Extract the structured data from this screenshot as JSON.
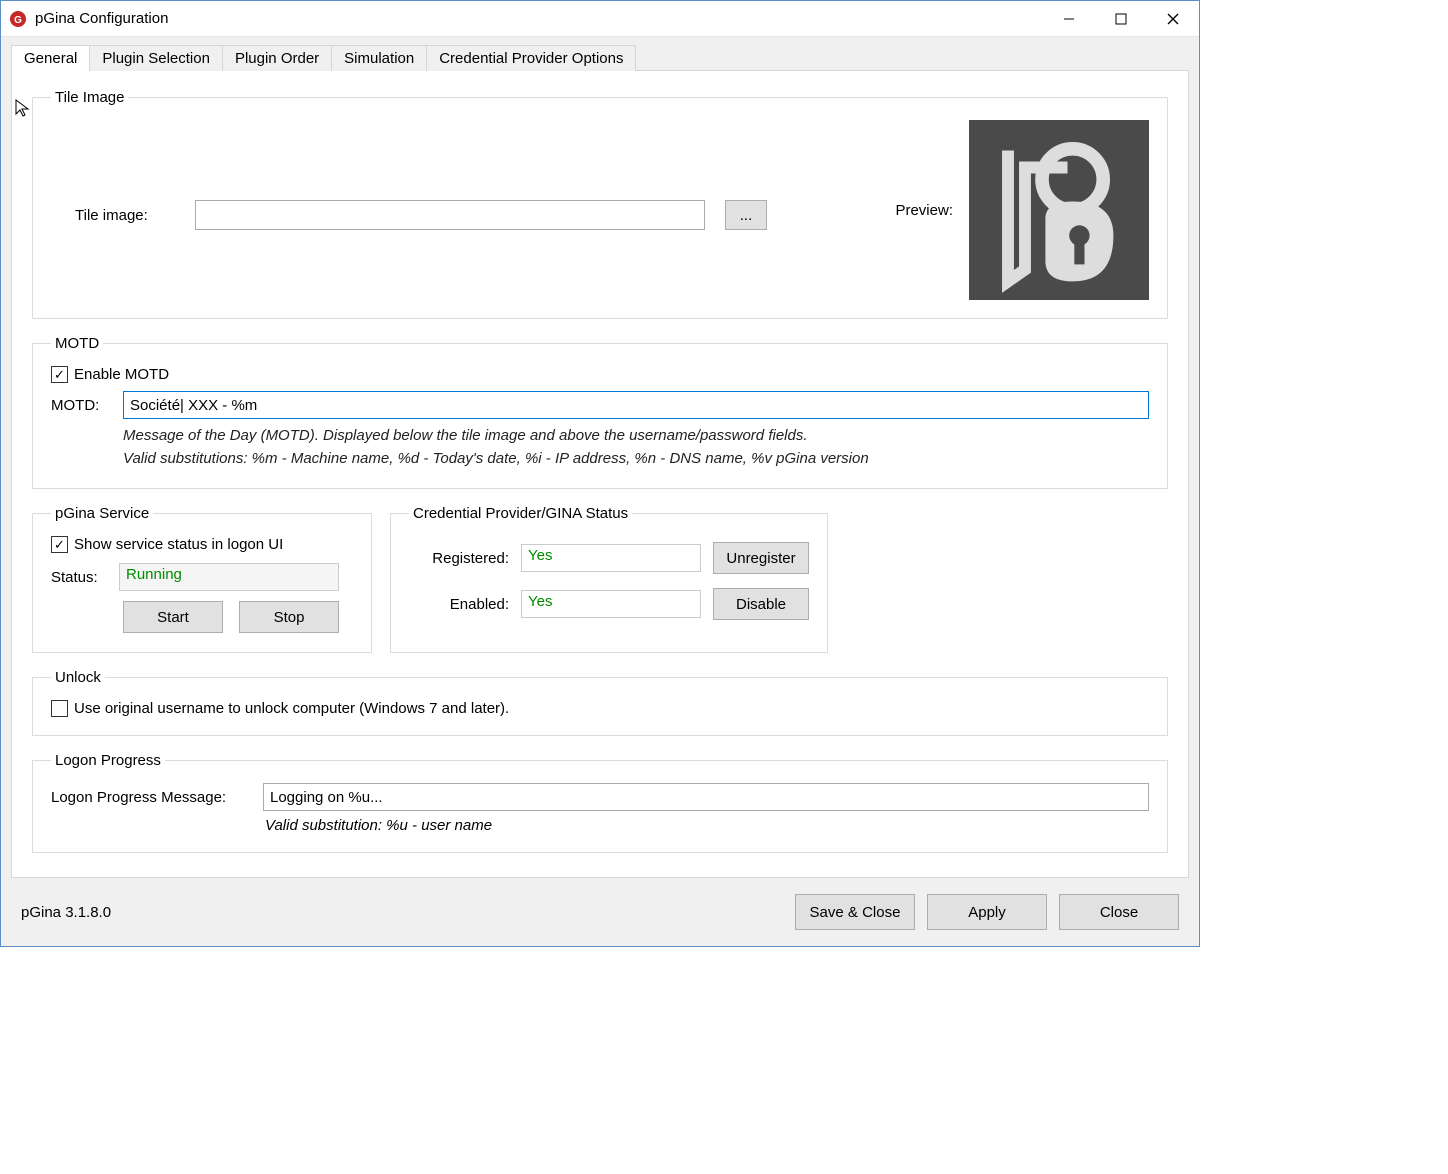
{
  "window": {
    "title": "pGina Configuration"
  },
  "tabs": [
    "General",
    "Plugin Selection",
    "Plugin Order",
    "Simulation",
    "Credential Provider Options"
  ],
  "tileImage": {
    "legend": "Tile Image",
    "label": "Tile image:",
    "value": "",
    "browse": "...",
    "previewLabel": "Preview:"
  },
  "motd": {
    "legend": "MOTD",
    "enableLabel": "Enable MOTD",
    "enabled": true,
    "label": "MOTD:",
    "value": "Société| XXX - %m",
    "hint1": "Message of the Day (MOTD).   Displayed below the tile image and  above the username/password fields.",
    "hint2": "Valid substitutions:   %m - Machine name, %d - Today's date, %i - IP address, %n - DNS name, %v pGina version"
  },
  "service": {
    "legend": "pGina Service",
    "showLabel": "Show service status in logon UI",
    "showChecked": true,
    "statusLabel": "Status:",
    "statusValue": "Running",
    "start": "Start",
    "stop": "Stop"
  },
  "cred": {
    "legend": "Credential Provider/GINA Status",
    "registeredLabel": "Registered:",
    "registeredValue": "Yes",
    "unregister": "Unregister",
    "enabledLabel": "Enabled:",
    "enabledValue": "Yes",
    "disable": "Disable"
  },
  "unlock": {
    "legend": "Unlock",
    "checked": false,
    "label": "Use original username to unlock computer (Windows 7 and later)."
  },
  "logonProgress": {
    "legend": "Logon Progress",
    "label": "Logon Progress Message:",
    "value": "Logging on %u...",
    "hint": "Valid substitution: %u - user name"
  },
  "footer": {
    "version": "pGina 3.1.8.0",
    "saveClose": "Save & Close",
    "apply": "Apply",
    "close": "Close"
  }
}
